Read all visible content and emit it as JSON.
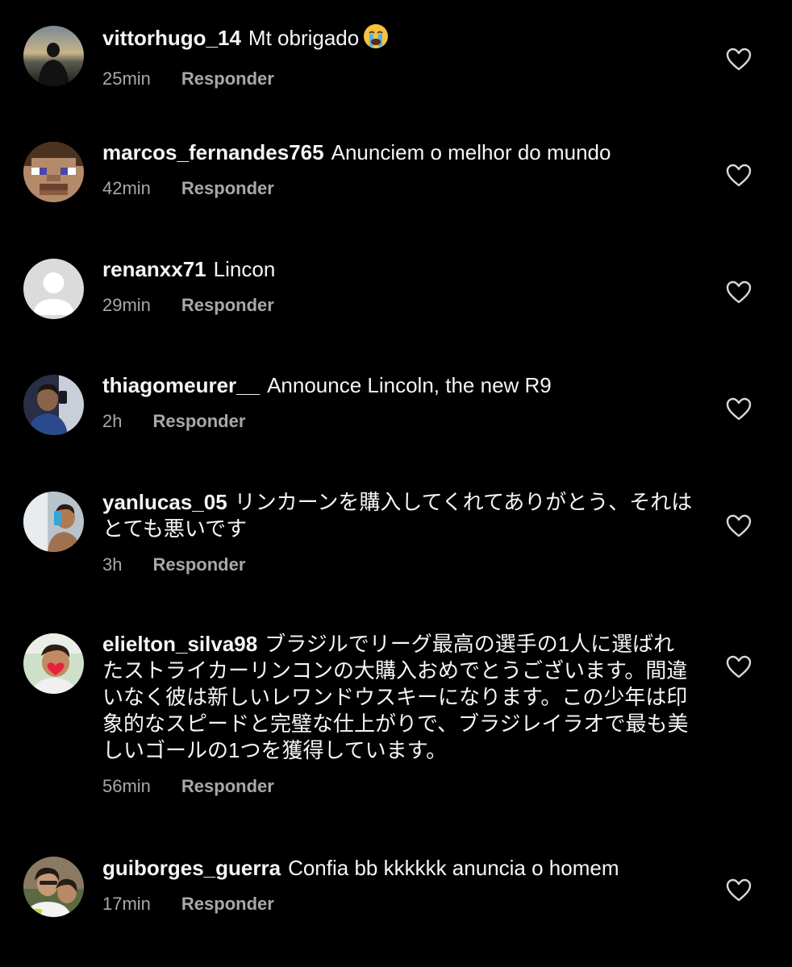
{
  "colors": {
    "background": "#000000",
    "text_primary": "#f5f5f5",
    "text_secondary": "#a8a8a8"
  },
  "reply_label": "Responder",
  "comments": [
    {
      "username": "vittorhugo_14",
      "text": "Mt obrigado",
      "emoji": "loudly-crying-face",
      "time": "25min",
      "avatar": "avatar-photo-sunset"
    },
    {
      "username": "marcos_fernandes765",
      "text": "Anunciem o melhor do mundo",
      "time": "42min",
      "avatar": "avatar-pixel-face"
    },
    {
      "username": "renanxx71",
      "text": "Lincon",
      "time": "29min",
      "avatar": "avatar-default"
    },
    {
      "username": "thiagomeurer__",
      "text": "Announce Lincoln, the new R9",
      "time": "2h",
      "avatar": "avatar-photo-selfie"
    },
    {
      "username": "yanlucas_05",
      "text": "リンカーンを購入してくれてありがとう、それはとても悪いです",
      "time": "3h",
      "avatar": "avatar-photo-mirror"
    },
    {
      "username": "elielton_silva98",
      "text": "ブラジルでリーグ最高の選手の1人に選ばれたストライカーリンコンの大購入おめでとうございます。間違いなく彼は新しいレワンドウスキーになります。この少年は印象的なスピードと完璧な仕上がりで、ブラジレイラオで最も美しいゴールの1つを獲得しています。",
      "time": "56min",
      "avatar": "avatar-photo-heart"
    },
    {
      "username": "guiborges_guerra",
      "text": "Confia bb kkkkkk anuncia o homem",
      "time": "17min",
      "avatar": "avatar-photo-couple"
    }
  ]
}
